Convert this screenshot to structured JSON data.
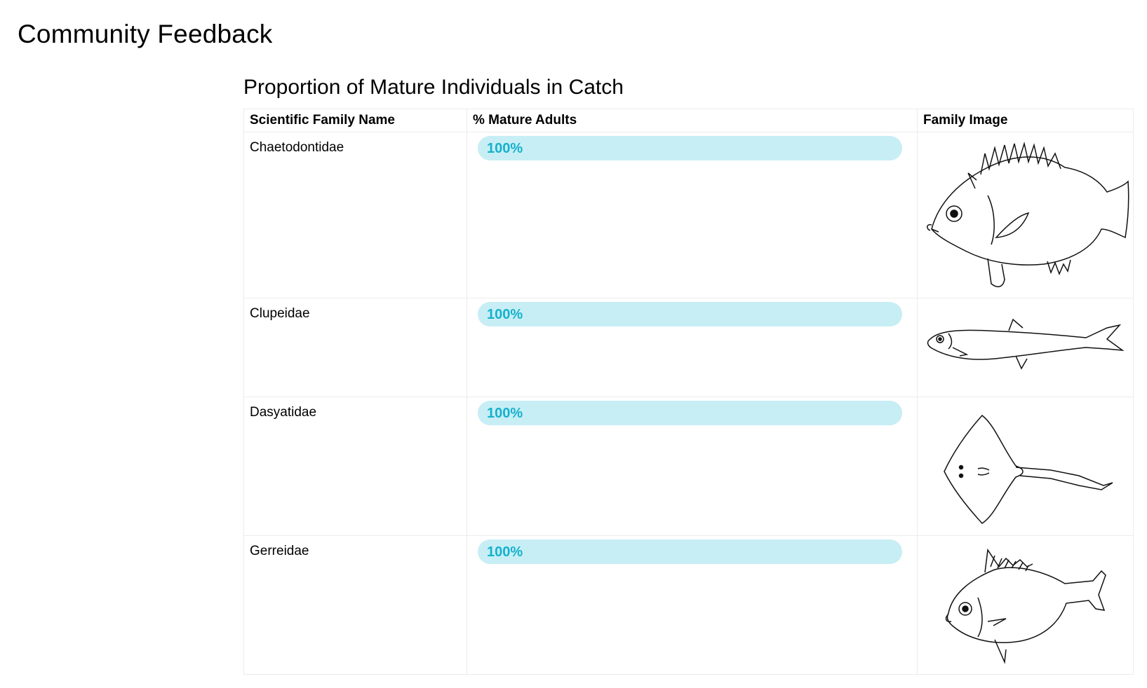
{
  "page": {
    "title": "Community Feedback"
  },
  "section": {
    "title": "Proportion of Mature Individuals in Catch"
  },
  "table": {
    "headers": [
      "Scientific Family Name",
      "% Mature Adults",
      "Family Image"
    ],
    "rows": [
      {
        "family": "Chaetodontidae",
        "mature_label": "100%",
        "mature_fraction": 1.0,
        "image_icon": "butterflyfish-drawing-icon"
      },
      {
        "family": "Clupeidae",
        "mature_label": "100%",
        "mature_fraction": 1.0,
        "image_icon": "herring-drawing-icon"
      },
      {
        "family": "Dasyatidae",
        "mature_label": "100%",
        "mature_fraction": 1.0,
        "image_icon": "stingray-drawing-icon"
      },
      {
        "family": "Gerreidae",
        "mature_label": "100%",
        "mature_fraction": 1.0,
        "image_icon": "mojarra-drawing-icon"
      }
    ]
  },
  "colors": {
    "bar_fill": "#c7eef5",
    "bar_text": "#17b1cc"
  }
}
